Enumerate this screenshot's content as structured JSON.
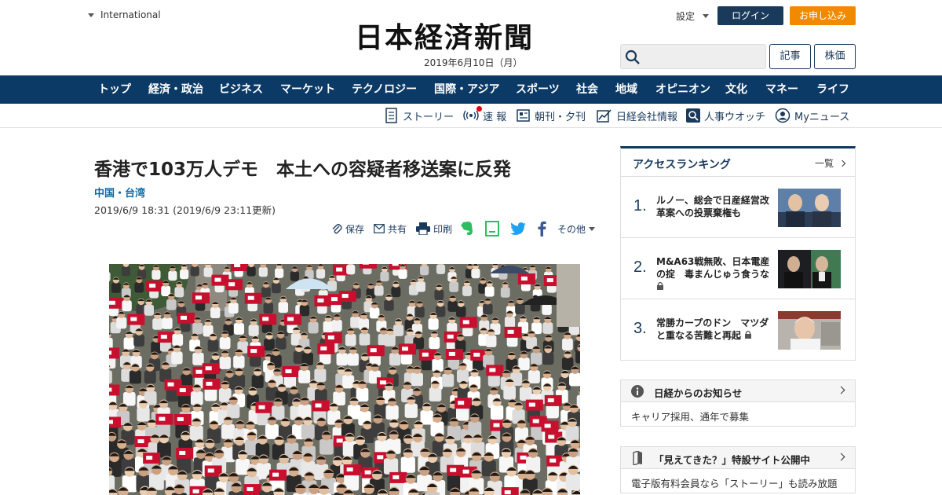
{
  "header": {
    "region_label": "International",
    "logo_text": "日本経済新聞",
    "date": "2019年6月10日（月）",
    "settings_label": "設定",
    "login_label": "ログイン",
    "apply_label": "お申し込み",
    "search_placeholder": "",
    "article_button": "記事",
    "stock_button": "株価"
  },
  "nav": {
    "items": [
      "トップ",
      "経済・政治",
      "ビジネス",
      "マーケット",
      "テクノロジー",
      "国際・アジア",
      "スポーツ",
      "社会",
      "地域",
      "オピニオン",
      "文化",
      "マネー",
      "ライフ"
    ]
  },
  "subnav": {
    "items": [
      "ストーリー",
      "速 報",
      "朝刊・夕刊",
      "日経会社情報",
      "人事ウオッチ",
      "Myニュース"
    ]
  },
  "article": {
    "headline": "香港で103万人デモ　本土への容疑者移送案に反発",
    "category": "中国・台湾",
    "timestamp": "2019/6/9 18:31 (2019/6/9 23:11更新)",
    "tools": {
      "save": "保存",
      "share": "共有",
      "print": "印刷",
      "more": "その他"
    }
  },
  "sidebar": {
    "ranking_title": "アクセスランキング",
    "ranking_all": "一覧",
    "ranking": [
      {
        "num": "1.",
        "text": "ルノー、総会で日産経営改革案への投票棄権も"
      },
      {
        "num": "2.",
        "text": "M&A63戦無敗、日本電産の掟　毒まんじゅう食うな"
      },
      {
        "num": "3.",
        "text": "常勝カープのドン　マツダと重なる苦難と再起"
      }
    ],
    "notice_title": "日経からのお知らせ",
    "notice_body": "キャリア採用、通年で募集",
    "promo_title": "「見えてきた？」特設サイト公開中",
    "promo_body": "電子版有料会員なら「ストーリー」も読み放題"
  },
  "colors": {
    "nav_bg": "#0c3a66",
    "login_bg": "#1a3a5c",
    "apply_bg": "#f28a00",
    "category": "#0a6aa8",
    "twitter": "#1da1f2",
    "facebook": "#3b5998",
    "evernote": "#2dbe60"
  }
}
